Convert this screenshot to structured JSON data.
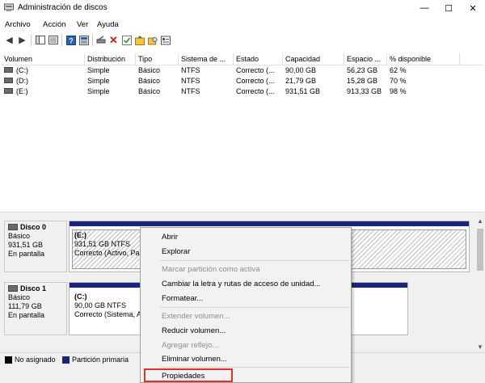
{
  "window": {
    "title": "Administración de discos",
    "minimize": "—",
    "maximize": "☐",
    "close": "✕"
  },
  "menu": [
    "Archivo",
    "Acción",
    "Ver",
    "Ayuda"
  ],
  "columns": [
    "Volumen",
    "Distribución",
    "Tipo",
    "Sistema de ...",
    "Estado",
    "Capacidad",
    "Espacio ...",
    "% disponible"
  ],
  "volumes": [
    {
      "name": "(C:)",
      "layout": "Simple",
      "type": "Básico",
      "fs": "NTFS",
      "status": "Correcto (...",
      "capacity": "90,00 GB",
      "free": "56,23 GB",
      "pct": "62 %"
    },
    {
      "name": "(D:)",
      "layout": "Simple",
      "type": "Básico",
      "fs": "NTFS",
      "status": "Correcto (...",
      "capacity": "21,79 GB",
      "free": "15,28 GB",
      "pct": "70 %"
    },
    {
      "name": "(E:)",
      "layout": "Simple",
      "type": "Básico",
      "fs": "NTFS",
      "status": "Correcto (...",
      "capacity": "931,51 GB",
      "free": "913,33 GB",
      "pct": "98 %"
    }
  ],
  "disks": [
    {
      "name": "Disco 0",
      "type": "Básico",
      "size": "931,51 GB",
      "state": "En pantalla",
      "partition": {
        "label": "(E:)",
        "size_fs": "931,51 GB NTFS",
        "status": "Correcto (Activo, Pa"
      }
    },
    {
      "name": "Disco 1",
      "type": "Básico",
      "size": "111,79 GB",
      "state": "En pantalla",
      "partition": {
        "label": "(C:)",
        "size_fs": "90,00 GB NTFS",
        "status": "Correcto (Sistema, A"
      }
    }
  ],
  "legend": {
    "unallocated": "No asignado",
    "primary": "Partición primaria"
  },
  "context_menu": {
    "items": [
      {
        "label": "Abrir",
        "enabled": true
      },
      {
        "label": "Explorar",
        "enabled": true
      },
      {
        "label": "Marcar partición como activa",
        "enabled": false
      },
      {
        "label": "Cambiar la letra y rutas de acceso de unidad...",
        "enabled": true
      },
      {
        "label": "Formatear...",
        "enabled": true
      },
      {
        "label": "Extender volumen...",
        "enabled": false
      },
      {
        "label": "Reducir volumen...",
        "enabled": true
      },
      {
        "label": "Agregar reflejo...",
        "enabled": false
      },
      {
        "label": "Eliminar volumen...",
        "enabled": true
      },
      {
        "label": "Propiedades",
        "enabled": true
      }
    ],
    "highlighted": "Propiedades"
  },
  "colors": {
    "partition_header": "#1a237e",
    "unallocated": "#000000",
    "primary": "#1a237e",
    "highlight_border": "#e0322b"
  }
}
